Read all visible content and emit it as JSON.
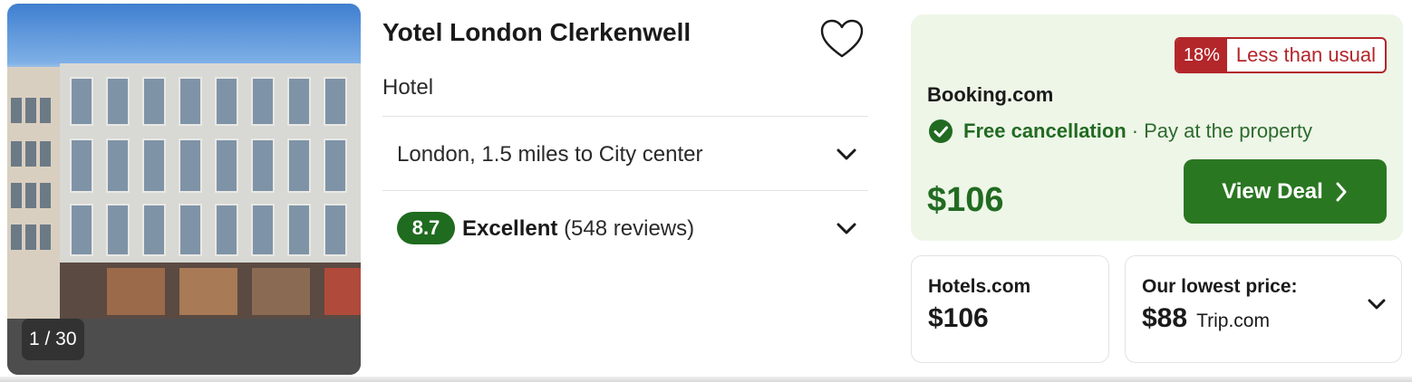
{
  "photo": {
    "counter": "1 / 30"
  },
  "hotel": {
    "name": "Yotel London Clerkenwell",
    "type": "Hotel",
    "location": "London, 1.5 miles to City center",
    "rating": {
      "score": "8.7",
      "label": "Excellent",
      "reviews": "(548 reviews)"
    }
  },
  "deal": {
    "badge_percent": "18%",
    "badge_text": "Less than usual",
    "provider": "Booking.com",
    "free_cancellation": "Free cancellation",
    "separator": "·",
    "payment": "Pay at the property",
    "price": "$106",
    "button_label": "View Deal"
  },
  "alternatives": [
    {
      "provider": "Hotels.com",
      "price": "$106"
    },
    {
      "label": "Our lowest price:",
      "price": "$88",
      "site": "Trip.com"
    }
  ],
  "colors": {
    "accent_green": "#2a7722",
    "rating_green": "#1f6b1f",
    "deal_bg": "#eef6e8",
    "badge_red": "#b3262a"
  },
  "icons": {
    "favorite": "heart-outline-icon",
    "expand": "chevron-down-icon",
    "check": "check-circle-icon",
    "arrow": "chevron-right-icon"
  }
}
